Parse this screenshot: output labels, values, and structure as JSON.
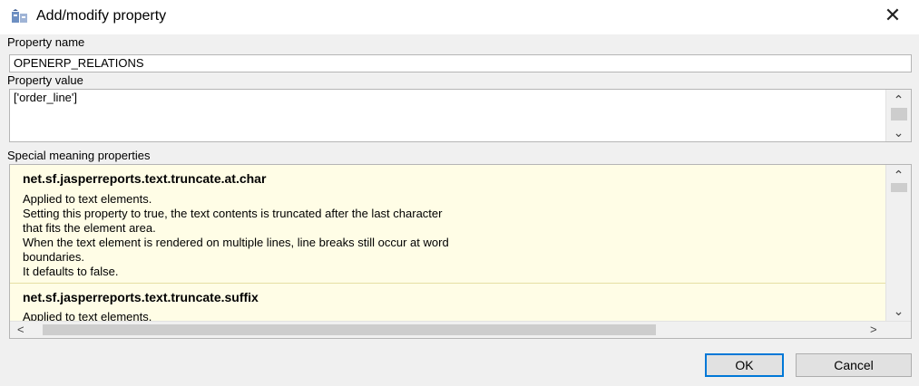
{
  "window": {
    "title": "Add/modify property",
    "close_glyph": "✕",
    "app_icon": "jasper-property-icon"
  },
  "property_name": {
    "label": "Property name",
    "value": "OPENERP_RELATIONS"
  },
  "property_value": {
    "label": "Property value",
    "value": "['order_line']"
  },
  "special": {
    "label": "Special meaning properties",
    "items": [
      {
        "name": "net.sf.jasperreports.text.truncate.at.char",
        "lines": [
          "Applied to text elements.",
          "Setting this property to true, the text contents is truncated after the last character",
          "that fits the element area.",
          "When the text element is rendered on multiple lines, line breaks still occur at word",
          "boundaries.",
          "It defaults to false."
        ]
      },
      {
        "name": "net.sf.jasperreports.text.truncate.suffix",
        "lines": [
          "Applied to text elements."
        ]
      }
    ]
  },
  "scroll": {
    "up": "⌃",
    "down": "⌄",
    "left": "<",
    "right": ">"
  },
  "buttons": {
    "ok": "OK",
    "cancel": "Cancel"
  }
}
